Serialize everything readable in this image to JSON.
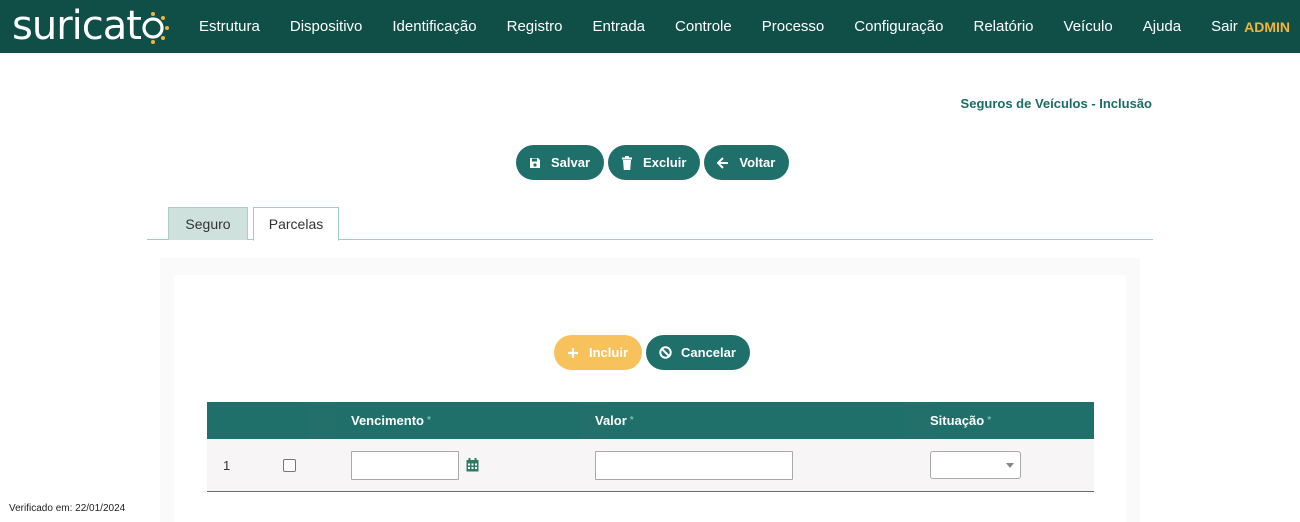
{
  "app": {
    "logo_text": "suricat",
    "user": "ADMIN"
  },
  "nav": {
    "items": [
      "Estrutura",
      "Dispositivo",
      "Identificação",
      "Registro",
      "Entrada",
      "Controle",
      "Processo",
      "Configuração",
      "Relatório",
      "Veículo",
      "Ajuda",
      "Sair"
    ]
  },
  "page": {
    "title": "Seguros de Veículos - Inclusão"
  },
  "toolbar": {
    "save_label": "Salvar",
    "delete_label": "Excluir",
    "back_label": "Voltar"
  },
  "tabs": [
    {
      "label": "Seguro",
      "active": false
    },
    {
      "label": "Parcelas",
      "active": true
    }
  ],
  "parcelas": {
    "add_label": "Incluir",
    "cancel_label": "Cancelar",
    "columns": {
      "vencimento": "Vencimento",
      "valor": "Valor",
      "situacao": "Situação",
      "required_mark": "*"
    },
    "rows": [
      {
        "index": "1",
        "checked": false,
        "vencimento": "",
        "valor": "",
        "situacao": ""
      }
    ]
  },
  "footer": {
    "verified": "Verificado em: 22/01/2024"
  },
  "colors": {
    "header_bg": "#0f4f47",
    "primary": "#1f706b",
    "accent": "#f2b53a",
    "add_button": "#f7c25c"
  },
  "icons": {
    "save": "floppy-disk-icon",
    "delete": "trash-icon",
    "back": "arrow-left-icon",
    "add": "plus-icon",
    "cancel": "ban-icon",
    "calendar": "calendar-icon"
  }
}
